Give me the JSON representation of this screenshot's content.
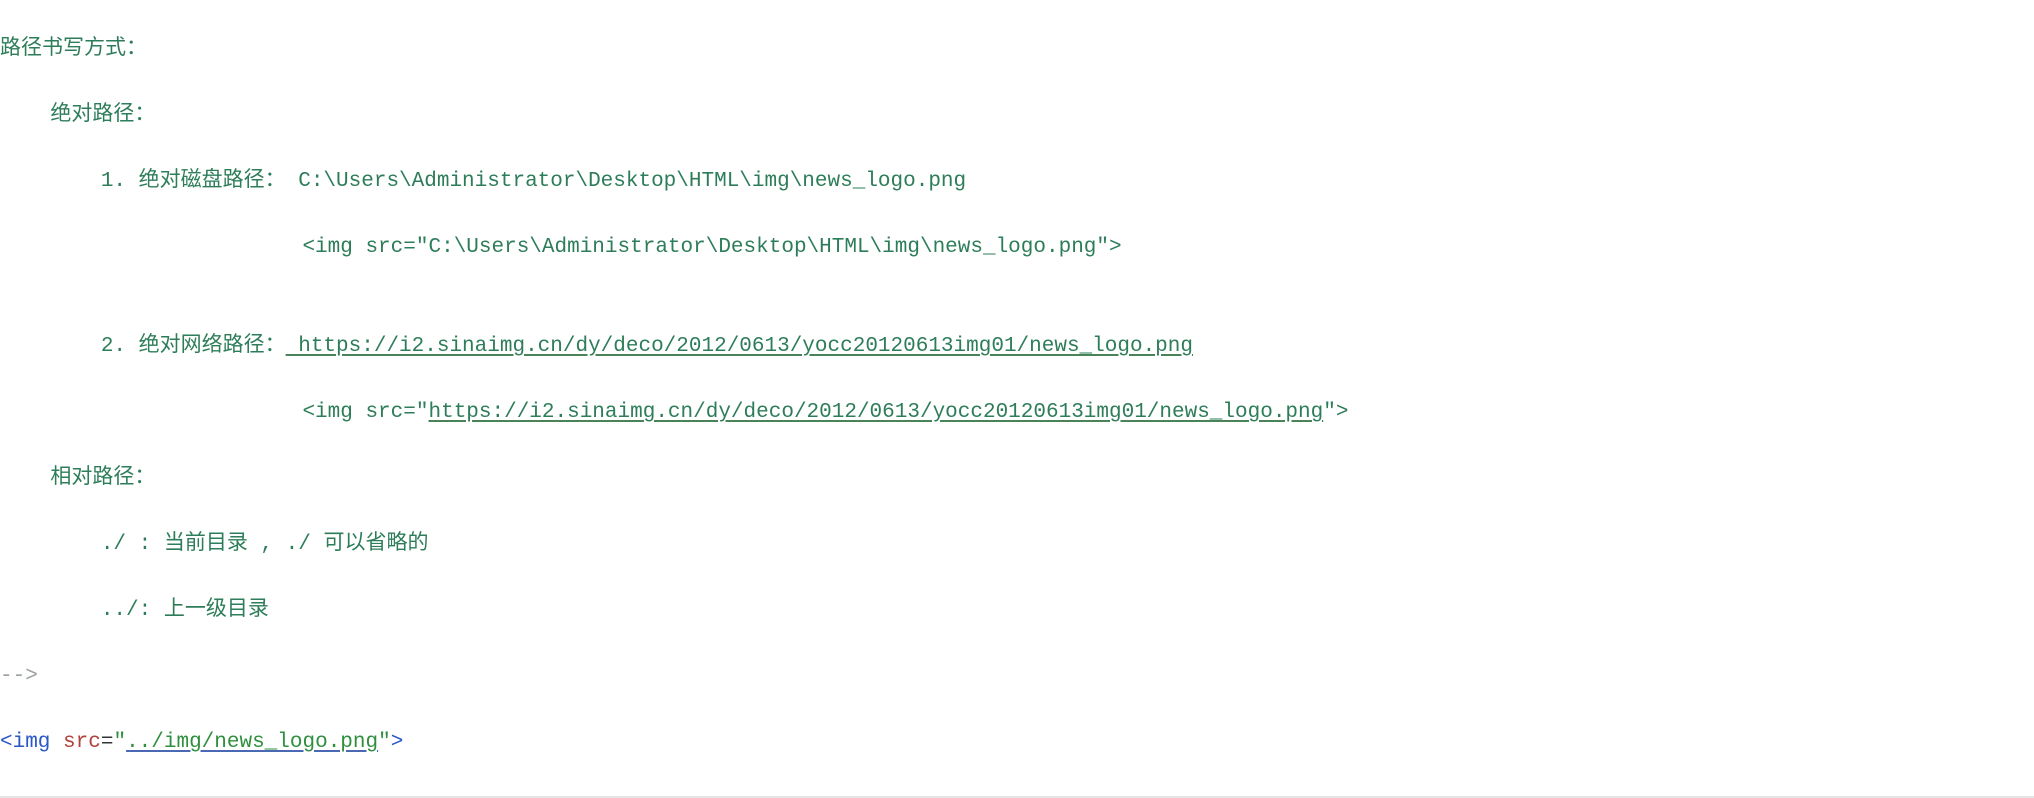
{
  "comment": {
    "header": "路径书写方式：",
    "abs_header": "    绝对路径：",
    "item1_label": "        1. 绝对磁盘路径：",
    "item1_path": " C:\\Users\\Administrator\\Desktop\\HTML\\img\\news_logo.png",
    "item1_code_prefix": "                        <img src=\"",
    "item1_code_value": "C:\\Users\\Administrator\\Desktop\\HTML\\img\\news_logo.png",
    "item1_code_suffix": "\">",
    "blank": "",
    "item2_label": "        2. 绝对网络路径：",
    "item2_url": " https://i2.sinaimg.cn/dy/deco/2012/0613/yocc20120613img01/news_logo.png",
    "item2_code_prefix": "                        <img src=\"",
    "item2_code_value": "https://i2.sinaimg.cn/dy/deco/2012/0613/yocc20120613img01/news_logo.png",
    "item2_code_suffix": "\">",
    "rel_header": "    相对路径：",
    "rel_line1": "        ./ : 当前目录 , ./ 可以省略的",
    "rel_line2": "        ../: 上一级目录",
    "end": "-->"
  },
  "code": {
    "open": "<img",
    "attr": "src",
    "eq": "=",
    "q": "\"",
    "value": "../img/news_logo.png",
    "close": ">"
  }
}
